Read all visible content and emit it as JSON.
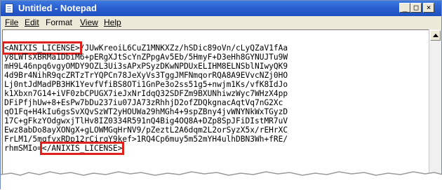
{
  "window": {
    "title": "Untitled - Notepad",
    "controls": {
      "minimize": "_",
      "maximize": "□",
      "close": "×"
    }
  },
  "menu": [
    {
      "label": "File"
    },
    {
      "label": "Edit"
    },
    {
      "label": "Format"
    },
    {
      "label": "View"
    },
    {
      "label": "Help"
    }
  ],
  "editor": {
    "open_tag": "<ANIXIS_LICENSE>",
    "first_line_rest": "/JUwKreoiL6CuZ1MNKXZz/hSDic89oVn/cLyQZaV1fAa",
    "lines": [
      "y8LWTsXBRMa1DbiM6+pERgXJtScYnZPpgAv5Eb/5HmyF+D3eHh8GYNUJTu9W",
      "mH9L46npq6vgyOMDY9OZL3Ui3sAPxPSyzDKwNPDUxELIHM8ELNSblNIwyQK9",
      "4d9Br4NihR9qcZRTzTrYQPCn78JeXyVs3TggJMFNmqorRQA8A9EVvcNZj0HO",
      "Lj0ntJdMadPB3HK1YevfVfiBS8OTi1GnPe3o2ss51g5+nwjm1Ks/vfK8IdJo",
      "k1Xbxn7G14+iVF0zbCPUGX7ieJxNrIdqQ32SDFZm9BXUNhiwzWyc7WHzX4pp",
      "DFiPfjhUw+8+EsPw7bDu237iu07JA73zRhhjD2ofZDQkgnacAqtVq7nG2Xc",
      "qO1Fq+H4kIu6gsSvXQvSzWT2yHOUWa29hMGh4+9spZBny4jvWNYNkWxTGyzD",
      "17C+gFkzYOdgwxjTlHv8IZ0334R591nQ4Big4OQ8A+DZp8SpJFiDIstMR7uV",
      "Ewz8abDo8ayXONgX+gLOWMGqHrNV9/pZeztL2A6dqm2L2orSyzX5x/rEHrXC",
      "FrLM1/5mqfyxRDp12rCirqY9kef>1RQ4Cp6muy5m52mYH4ulhDBN3Wh+fRE/"
    ],
    "last_line_prefix": "rhmSMIo=",
    "close_tag": "</ANIXIS_LICENSE>"
  }
}
